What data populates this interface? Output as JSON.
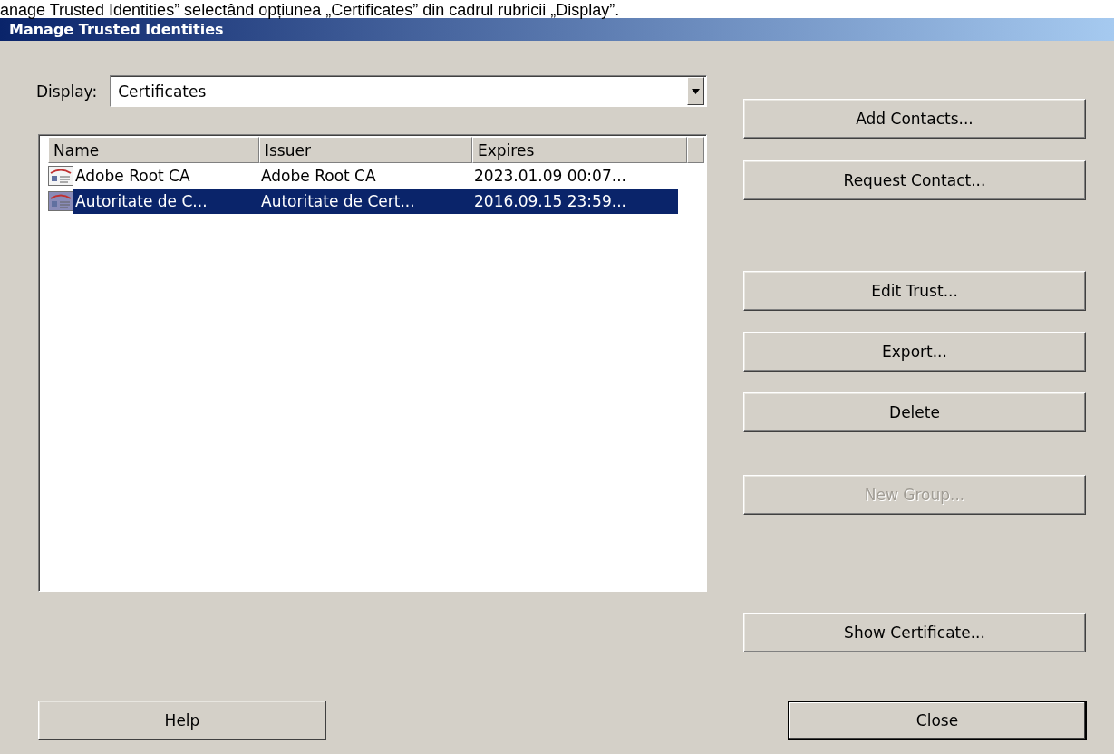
{
  "caption": "anage Trusted Identities” selectând opțiunea „Certificates” din cadrul rubricii „Display”.",
  "window": {
    "title": "Manage Trusted Identities"
  },
  "display": {
    "label": "Display:",
    "value": "Certificates"
  },
  "table": {
    "columns": [
      "Name",
      "Issuer",
      "Expires"
    ],
    "rows": [
      {
        "cells": [
          "Adobe Root CA",
          "Adobe Root CA",
          "2023.01.09 00:07..."
        ],
        "selected": false
      },
      {
        "cells": [
          "Autoritate de C...",
          "Autoritate de Cert...",
          "2016.09.15 23:59..."
        ],
        "selected": true
      }
    ]
  },
  "side_buttons": [
    {
      "label": "Add Contacts...",
      "disabled": false
    },
    {
      "label": "Request Contact...",
      "disabled": false
    },
    {
      "label": "Edit Trust...",
      "disabled": false
    },
    {
      "label": "Export...",
      "disabled": false
    },
    {
      "label": "Delete",
      "disabled": false
    },
    {
      "label": "New Group...",
      "disabled": true
    },
    {
      "label": "Show Certificate...",
      "disabled": false
    }
  ],
  "footer_buttons": [
    {
      "label": "Help",
      "default": false
    },
    {
      "label": "Close",
      "default": true
    }
  ]
}
